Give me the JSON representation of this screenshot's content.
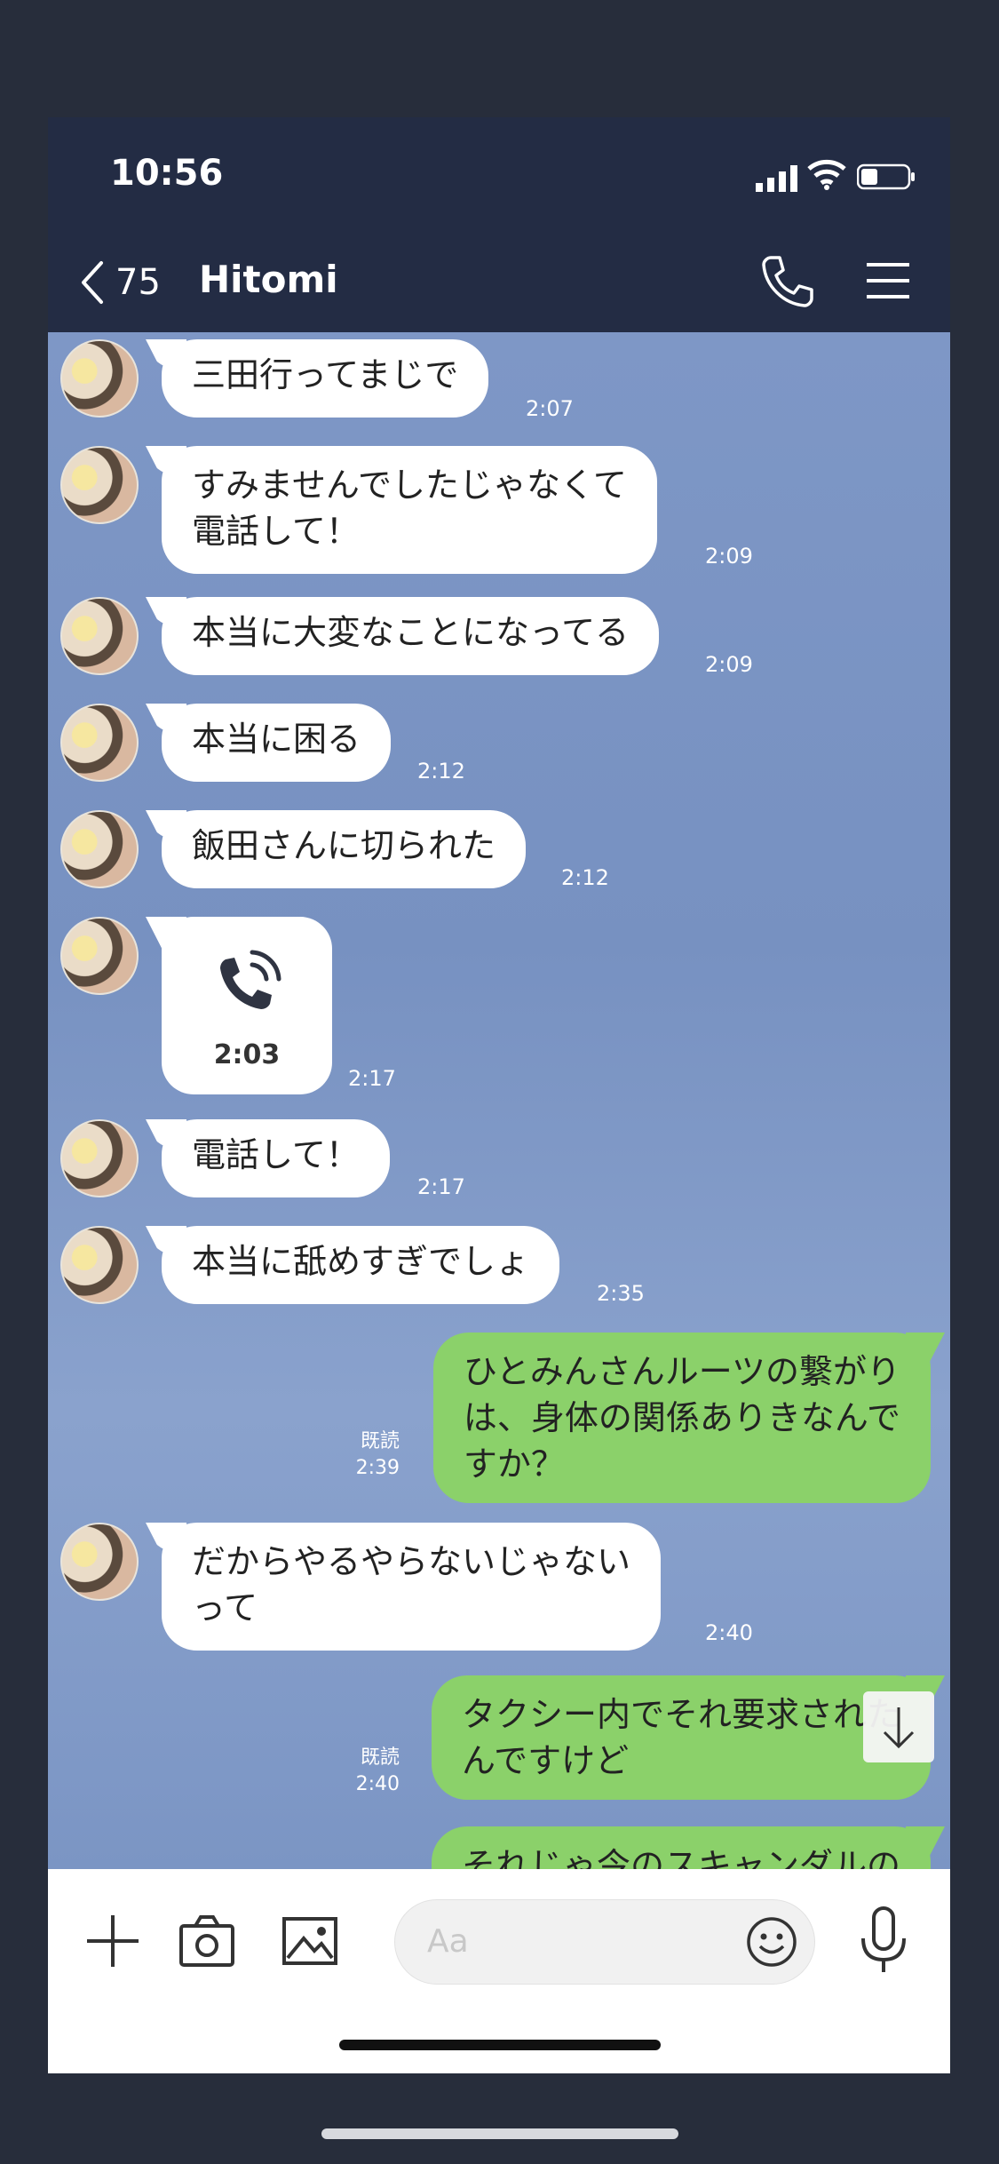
{
  "status": {
    "time": "10:56"
  },
  "header": {
    "back_count": "75",
    "title": "Hitomi"
  },
  "icons": {
    "back": "chevron-left-icon",
    "call": "phone-icon",
    "menu": "hamburger-menu-icon",
    "add": "plus-icon",
    "camera": "camera-icon",
    "gallery": "image-icon",
    "emoji": "smiley-icon",
    "mic": "microphone-icon",
    "scroll": "arrow-down-icon"
  },
  "messages": [
    {
      "type": "in",
      "text": "三田行ってまじで",
      "time": "2:07"
    },
    {
      "type": "in",
      "line1": "すみませんでしたじゃなくて",
      "line2": "電話して！",
      "time": "2:09"
    },
    {
      "type": "in",
      "text": "本当に大変なことになってる",
      "time": "2:09"
    },
    {
      "type": "in",
      "text": "本当に困る",
      "time": "2:12"
    },
    {
      "type": "in",
      "text": "飯田さんに切られた",
      "time": "2:12"
    },
    {
      "type": "call",
      "duration": "2:03",
      "time": "2:17"
    },
    {
      "type": "in",
      "text": "電話して！",
      "time": "2:17"
    },
    {
      "type": "in",
      "text": "本当に舐めすぎでしょ",
      "time": "2:35"
    },
    {
      "type": "out",
      "line1": "ひとみんさんルーツの繋がり",
      "line2": "は、身体の関係ありきなんで",
      "line3": "すか？",
      "read": "既読",
      "time": "2:39"
    },
    {
      "type": "in",
      "line1": "だからやるやらないじゃない",
      "line2": "って",
      "time": "2:40"
    },
    {
      "type": "out",
      "line1": "タクシー内でそれ要求された",
      "line2": "んですけど",
      "read": "既読",
      "time": "2:40"
    },
    {
      "type": "out",
      "text": "それじゃ今のスキャンダルの"
    }
  ],
  "input": {
    "placeholder": "Aa"
  },
  "colors": {
    "header": "#232c44",
    "chat_bg": "#7b95c4",
    "bubble_out": "#8bd16a",
    "bubble_in": "#ffffff"
  }
}
